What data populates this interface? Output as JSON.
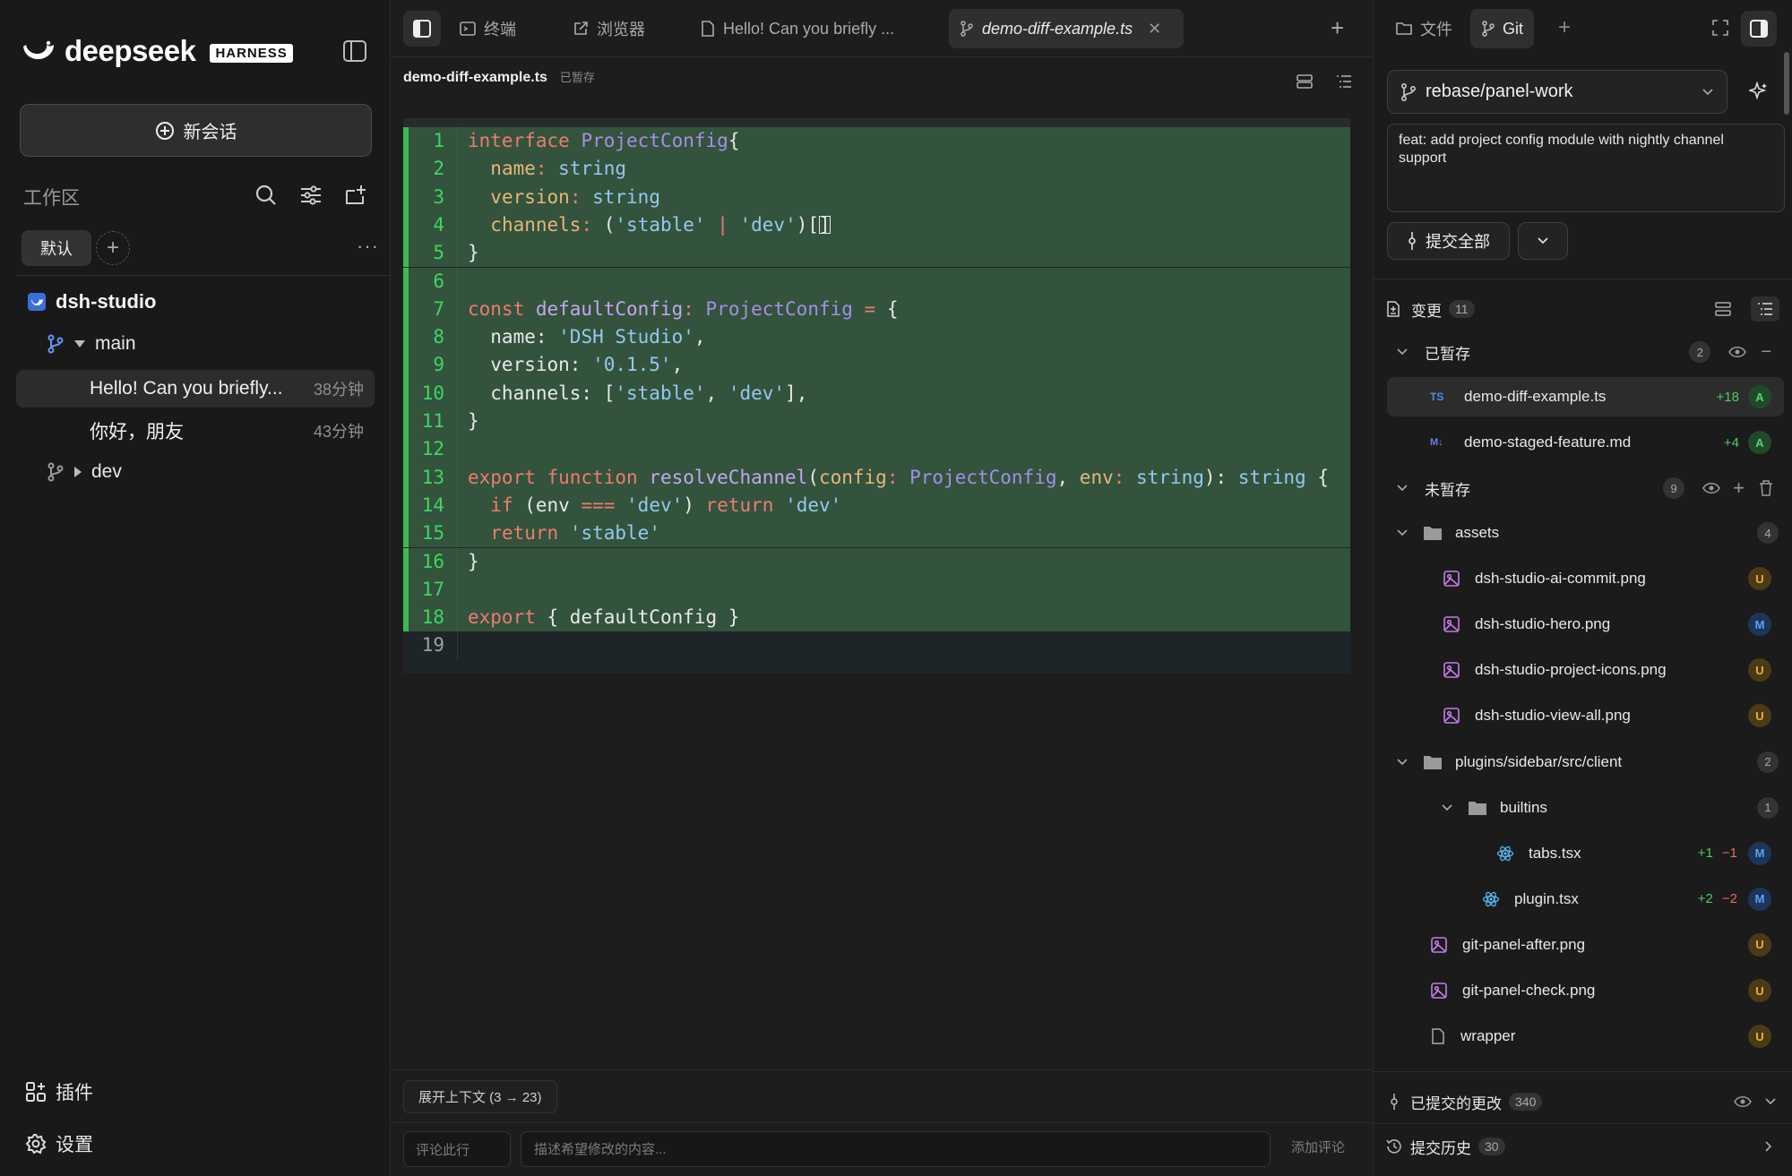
{
  "sidebar": {
    "brand": "deepseek",
    "brand_badge": "HARNESS",
    "new_chat_label": "新会话",
    "workspace_label": "工作区",
    "chip_default": "默认",
    "project": "dsh-studio",
    "branch_main": "main",
    "sessions": [
      {
        "title": "Hello! Can you briefly...",
        "time": "38分钟"
      },
      {
        "title": "你好，朋友",
        "time": "43分钟"
      }
    ],
    "branch_dev": "dev",
    "plugins_label": "插件",
    "settings_label": "设置"
  },
  "tabs": [
    {
      "label": "终端",
      "icon": "terminal-icon"
    },
    {
      "label": "浏览器",
      "icon": "external-link-icon"
    },
    {
      "label": "Hello! Can you briefly ...",
      "icon": "document-icon"
    },
    {
      "label": "demo-diff-example.ts",
      "icon": "git-branch-icon"
    }
  ],
  "editor": {
    "file_name": "demo-diff-example.ts",
    "file_status": "已暂存",
    "lines": [
      {
        "n": "1",
        "added": true,
        "tokens": [
          [
            "kw",
            "interface "
          ],
          [
            "ty",
            "ProjectConfig"
          ],
          [
            "",
            "{"
          ]
        ]
      },
      {
        "n": "2",
        "added": true,
        "tokens": [
          [
            "",
            "  "
          ],
          [
            "prop",
            "name"
          ],
          [
            "op",
            ": "
          ],
          [
            "str",
            "string"
          ]
        ]
      },
      {
        "n": "3",
        "added": true,
        "tokens": [
          [
            "",
            "  "
          ],
          [
            "prop",
            "version"
          ],
          [
            "op",
            ": "
          ],
          [
            "str",
            "string"
          ]
        ]
      },
      {
        "n": "4",
        "added": true,
        "tokens": [
          [
            "",
            "  "
          ],
          [
            "prop",
            "channels"
          ],
          [
            "op",
            ": "
          ],
          [
            "",
            "("
          ],
          [
            "str",
            "'stable'"
          ],
          [
            "op",
            " | "
          ],
          [
            "str",
            "'dev'"
          ],
          [
            "",
            ")[]"
          ]
        ]
      },
      {
        "n": "5",
        "added": true,
        "tokens": [
          [
            "",
            "}"
          ]
        ]
      },
      {
        "n": "6",
        "added": true,
        "tokens": [
          [
            "",
            ""
          ]
        ]
      },
      {
        "n": "7",
        "added": true,
        "tokens": [
          [
            "kw",
            "const "
          ],
          [
            "fn",
            "defaultConfig"
          ],
          [
            "op",
            ": "
          ],
          [
            "ty",
            "ProjectConfig"
          ],
          [
            "op",
            " = "
          ],
          [
            "",
            "{"
          ]
        ]
      },
      {
        "n": "8",
        "added": true,
        "tokens": [
          [
            "",
            "  name: "
          ],
          [
            "str",
            "'DSH Studio'"
          ],
          [
            "",
            ","
          ]
        ]
      },
      {
        "n": "9",
        "added": true,
        "tokens": [
          [
            "",
            "  version: "
          ],
          [
            "str",
            "'0.1.5'"
          ],
          [
            "",
            ","
          ]
        ]
      },
      {
        "n": "10",
        "added": true,
        "tokens": [
          [
            "",
            "  channels: ["
          ],
          [
            "str",
            "'stable'"
          ],
          [
            "",
            ", "
          ],
          [
            "str",
            "'dev'"
          ],
          [
            "",
            "],"
          ]
        ]
      },
      {
        "n": "11",
        "added": true,
        "tokens": [
          [
            "",
            "}"
          ]
        ]
      },
      {
        "n": "12",
        "added": true,
        "tokens": [
          [
            "",
            ""
          ]
        ]
      },
      {
        "n": "13",
        "added": true,
        "tokens": [
          [
            "kw",
            "export function "
          ],
          [
            "fn",
            "resolveChannel"
          ],
          [
            "",
            "("
          ],
          [
            "prop",
            "config"
          ],
          [
            "op",
            ": "
          ],
          [
            "ty",
            "ProjectConfig"
          ],
          [
            "",
            ", "
          ],
          [
            "prop",
            "env"
          ],
          [
            "op",
            ": "
          ],
          [
            "str",
            "string"
          ],
          [
            "",
            "): "
          ],
          [
            "str",
            "string"
          ],
          [
            "",
            ""
          ]
        ]
      },
      {
        "n": "14",
        "added": true,
        "tokens": [
          [
            "",
            "  "
          ],
          [
            "kw",
            "if "
          ],
          [
            "",
            "(env "
          ],
          [
            "op",
            "=== "
          ],
          [
            "str",
            "'dev'"
          ],
          [
            "",
            ") "
          ],
          [
            "kw",
            "return "
          ],
          [
            "str",
            "'dev'"
          ]
        ]
      },
      {
        "n": "15",
        "added": true,
        "tokens": [
          [
            "",
            "  "
          ],
          [
            "kw",
            "return "
          ],
          [
            "str",
            "'stable'"
          ]
        ]
      },
      {
        "n": "16",
        "added": true,
        "tokens": [
          [
            "",
            "}"
          ]
        ]
      },
      {
        "n": "17",
        "added": true,
        "tokens": [
          [
            "",
            ""
          ]
        ]
      },
      {
        "n": "18",
        "added": true,
        "tokens": [
          [
            "kw",
            "export "
          ],
          [
            "",
            "{ defaultConfig }"
          ]
        ]
      },
      {
        "n": "19",
        "added": false,
        "tokens": [
          [
            "",
            ""
          ]
        ]
      }
    ],
    "expand_context_label": "展开上下文 (3 → 23)",
    "comment_line_label": "评论此行",
    "comment_placeholder": "描述希望修改的内容...",
    "add_comment_label": "添加评论"
  },
  "git": {
    "tab_files": "文件",
    "tab_git": "Git",
    "branch": "rebase/panel-work",
    "commit_message": "feat: add project config module with nightly channel support",
    "commit_all_label": "提交全部",
    "changes_label": "变更",
    "changes_count": "11",
    "staged_label": "已暂存",
    "staged_count": "2",
    "unstaged_label": "未暂存",
    "unstaged_count": "9",
    "committed_label": "已提交的更改",
    "committed_count": "340",
    "history_label": "提交历史",
    "history_count": "30",
    "staged_files": [
      {
        "name": "demo-diff-example.ts",
        "icon": "typescript-icon",
        "adds": "+18",
        "status": "A"
      },
      {
        "name": "demo-staged-feature.md",
        "icon": "markdown-icon",
        "adds": "+4",
        "status": "A"
      }
    ],
    "unstaged": [
      {
        "kind": "folder",
        "name": "assets",
        "count": "4",
        "depth": 0
      },
      {
        "kind": "file",
        "name": "dsh-studio-ai-commit.png",
        "icon": "image-icon",
        "status": "U",
        "depth": 1
      },
      {
        "kind": "file",
        "name": "dsh-studio-hero.png",
        "icon": "image-icon",
        "status": "M",
        "depth": 1
      },
      {
        "kind": "file",
        "name": "dsh-studio-project-icons.png",
        "icon": "image-icon",
        "status": "U",
        "depth": 1
      },
      {
        "kind": "file",
        "name": "dsh-studio-view-all.png",
        "icon": "image-icon",
        "status": "U",
        "depth": 1
      },
      {
        "kind": "folder",
        "name": "plugins/sidebar/src/client",
        "count": "2",
        "depth": 0
      },
      {
        "kind": "folder",
        "name": "builtins",
        "count": "1",
        "depth": 1
      },
      {
        "kind": "file",
        "name": "tabs.tsx",
        "icon": "react-icon",
        "adds": "+1",
        "dels": "−1",
        "status": "M",
        "depth": 2
      },
      {
        "kind": "file",
        "name": "plugin.tsx",
        "icon": "react-icon",
        "adds": "+2",
        "dels": "−2",
        "status": "M",
        "depth": 1.5
      },
      {
        "kind": "file",
        "name": "git-panel-after.png",
        "icon": "image-icon",
        "status": "U",
        "depth": 0
      },
      {
        "kind": "file",
        "name": "git-panel-check.png",
        "icon": "image-icon",
        "status": "U",
        "depth": 0
      },
      {
        "kind": "file",
        "name": "wrapper",
        "icon": "file-icon",
        "status": "U",
        "depth": 0
      }
    ]
  },
  "colors": {
    "added_bg": "#33533d",
    "added_bar": "#3bbb54",
    "status_added": "#58d36e",
    "status_untracked": "#e2b33e",
    "status_modified": "#5ea2f0"
  }
}
